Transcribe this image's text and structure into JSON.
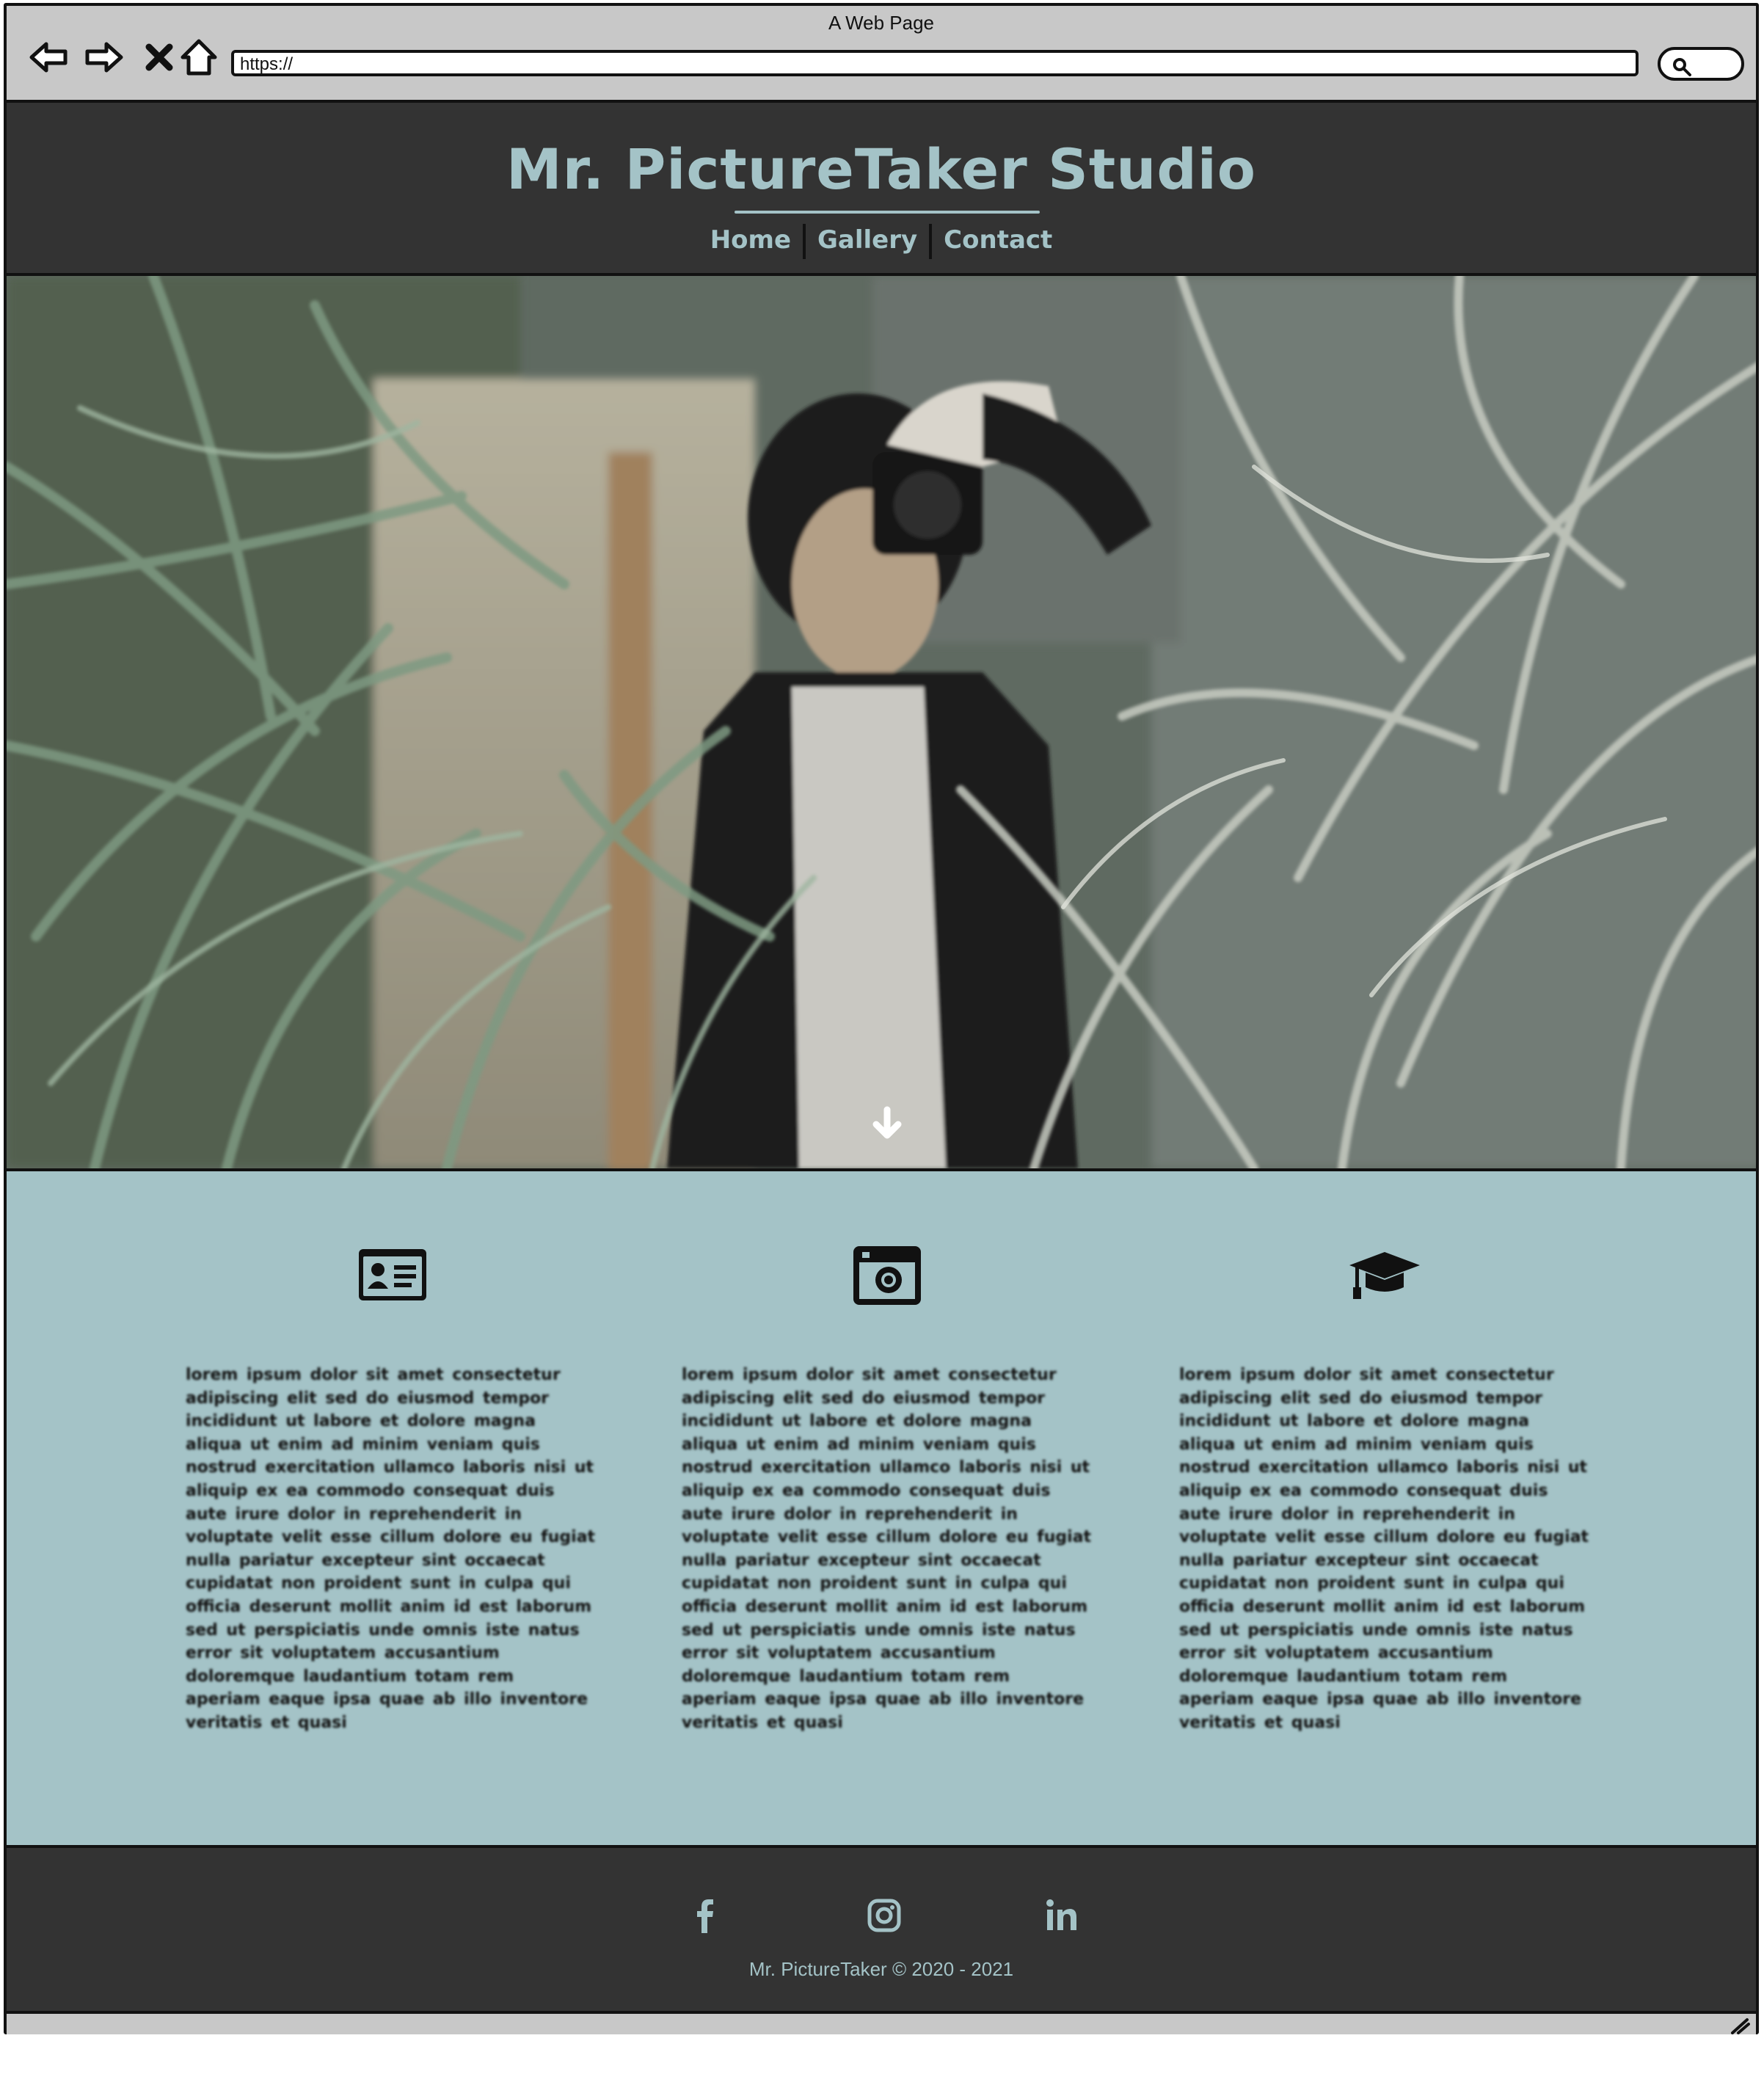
{
  "browser": {
    "window_title": "A Web Page",
    "address": "https://",
    "buttons": {
      "back_icon": "back-arrow-icon",
      "forward_icon": "forward-arrow-icon",
      "stop_icon": "close-icon",
      "home_icon": "home-icon",
      "search_icon": "search-icon"
    }
  },
  "header": {
    "title": "Mr. PictureTaker Studio",
    "nav": [
      {
        "label": "Home"
      },
      {
        "label": "Gallery"
      },
      {
        "label": "Contact"
      }
    ]
  },
  "hero": {
    "image_alt": "",
    "scroll_icon": "arrow-down-icon"
  },
  "info": {
    "columns": [
      {
        "icon": "id-card-icon",
        "text": "lorem ipsum dolor sit amet consectetur adipiscing elit sed do eiusmod tempor incididunt ut labore et dolore magna aliqua ut enim ad minim veniam quis nostrud exercitation ullamco laboris nisi ut aliquip ex ea commodo consequat duis aute irure dolor in reprehenderit in voluptate velit esse cillum dolore eu fugiat nulla pariatur excepteur sint occaecat cupidatat non proident sunt in culpa qui officia deserunt mollit anim id est laborum sed ut perspiciatis unde omnis iste natus error sit voluptatem accusantium doloremque laudantium totam rem aperiam eaque ipsa quae ab illo inventore veritatis et quasi"
      },
      {
        "icon": "camera-icon",
        "text": "lorem ipsum dolor sit amet consectetur adipiscing elit sed do eiusmod tempor incididunt ut labore et dolore magna aliqua ut enim ad minim veniam quis nostrud exercitation ullamco laboris nisi ut aliquip ex ea commodo consequat duis aute irure dolor in reprehenderit in voluptate velit esse cillum dolore eu fugiat nulla pariatur excepteur sint occaecat cupidatat non proident sunt in culpa qui officia deserunt mollit anim id est laborum sed ut perspiciatis unde omnis iste natus error sit voluptatem accusantium doloremque laudantium totam rem aperiam eaque ipsa quae ab illo inventore veritatis et quasi"
      },
      {
        "icon": "graduation-cap-icon",
        "text": "lorem ipsum dolor sit amet consectetur adipiscing elit sed do eiusmod tempor incididunt ut labore et dolore magna aliqua ut enim ad minim veniam quis nostrud exercitation ullamco laboris nisi ut aliquip ex ea commodo consequat duis aute irure dolor in reprehenderit in voluptate velit esse cillum dolore eu fugiat nulla pariatur excepteur sint occaecat cupidatat non proident sunt in culpa qui officia deserunt mollit anim id est laborum sed ut perspiciatis unde omnis iste natus error sit voluptatem accusantium doloremque laudantium totam rem aperiam eaque ipsa quae ab illo inventore veritatis et quasi"
      }
    ]
  },
  "footer": {
    "social": [
      {
        "icon": "facebook-icon"
      },
      {
        "icon": "instagram-icon"
      },
      {
        "icon": "linkedin-icon"
      }
    ],
    "copyright": "Mr. PictureTaker © 2020 - 2021"
  },
  "colors": {
    "dark": "#333333",
    "accent": "#a4c3c7",
    "chrome": "#c8c8c8"
  }
}
